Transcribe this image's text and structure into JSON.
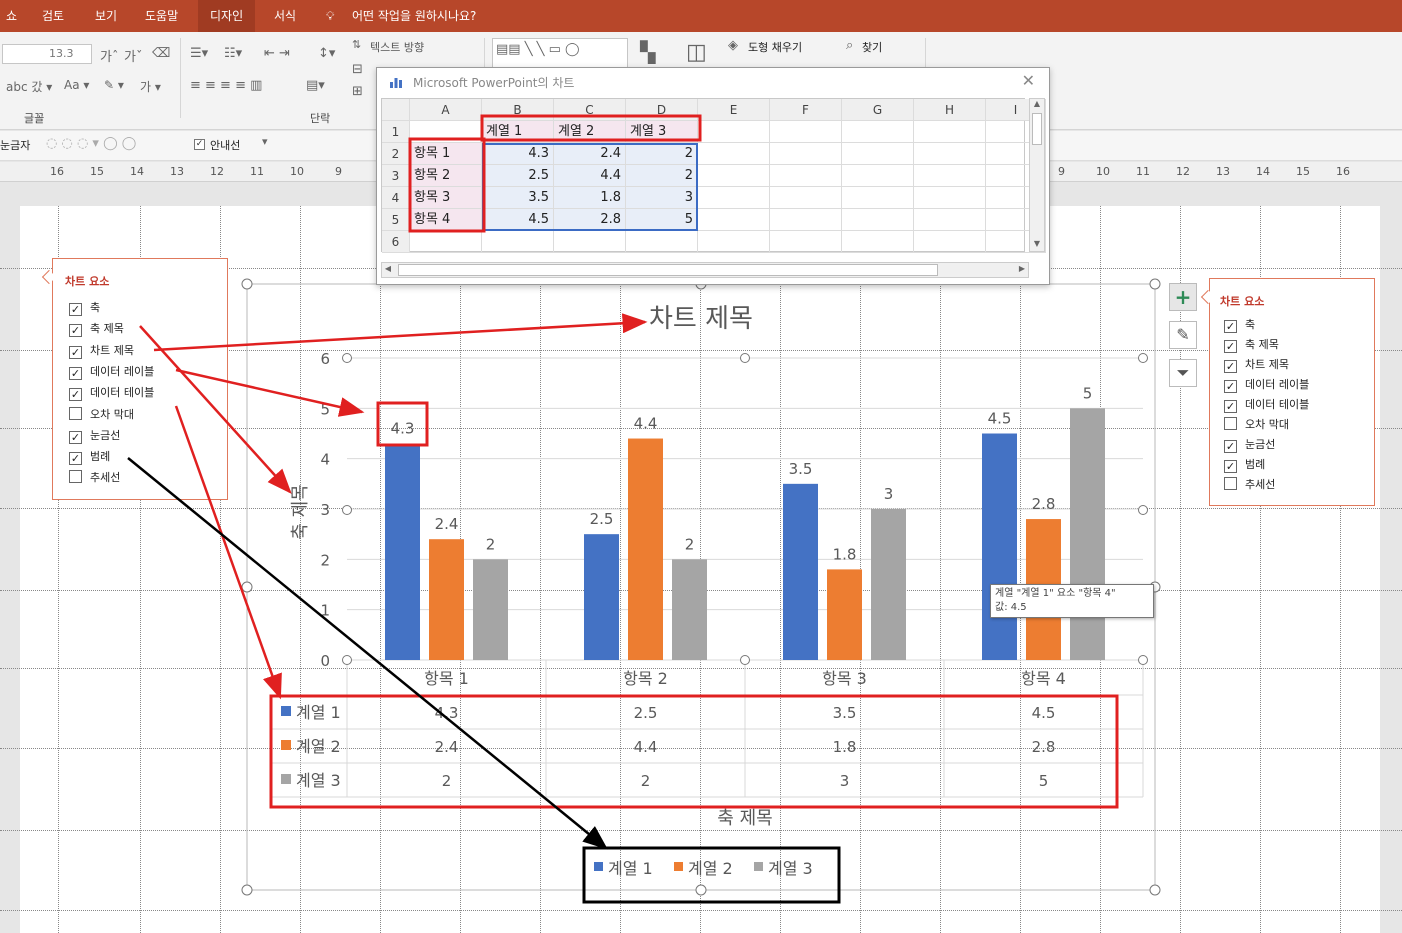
{
  "ribbon": {
    "tabs": [
      "쇼",
      "검토",
      "보기",
      "도움말",
      "디자인",
      "서식"
    ],
    "active_tab": "디자인",
    "tell_me": "어떤 작업을 원하시나요?",
    "font_size": "13.3",
    "groups": {
      "font": "글꼴",
      "paragraph": "단락"
    },
    "text_direction": "텍스트 방향",
    "shape_fill": "도형 채우기",
    "find": "찾기",
    "guides_prefix": "눈금자",
    "guides_label": "안내선"
  },
  "ruler": {
    "ticks_left": [
      "16",
      "15",
      "14",
      "13",
      "12",
      "11",
      "10",
      "9"
    ],
    "ticks_right": [
      "9",
      "10",
      "11",
      "12",
      "13",
      "14",
      "15",
      "16"
    ]
  },
  "excel": {
    "title": "Microsoft PowerPoint의 차트",
    "columns": [
      "A",
      "B",
      "C",
      "D",
      "E",
      "F",
      "G",
      "H",
      "I"
    ],
    "row_numbers": [
      "1",
      "2",
      "3",
      "4",
      "5",
      "6"
    ],
    "headers": [
      "계열 1",
      "계열 2",
      "계열 3"
    ],
    "rows": [
      {
        "label": "항목 1",
        "values": [
          "4.3",
          "2.4",
          "2"
        ]
      },
      {
        "label": "항목 2",
        "values": [
          "2.5",
          "4.4",
          "2"
        ]
      },
      {
        "label": "항목 3",
        "values": [
          "3.5",
          "1.8",
          "3"
        ]
      },
      {
        "label": "항목 4",
        "values": [
          "4.5",
          "2.8",
          "5"
        ]
      }
    ]
  },
  "chart_elements_left": {
    "title": "차트 요소",
    "items": [
      {
        "label": "축",
        "checked": true
      },
      {
        "label": "축 제목",
        "checked": true
      },
      {
        "label": "차트 제목",
        "checked": true
      },
      {
        "label": "데이터 레이블",
        "checked": true
      },
      {
        "label": "데이터 테이블",
        "checked": true
      },
      {
        "label": "오차 막대",
        "checked": false
      },
      {
        "label": "눈금선",
        "checked": true
      },
      {
        "label": "범례",
        "checked": true
      },
      {
        "label": "추세선",
        "checked": false
      }
    ]
  },
  "chart_elements_right": {
    "title": "차트 요소",
    "items": [
      {
        "label": "축",
        "checked": true
      },
      {
        "label": "축 제목",
        "checked": true
      },
      {
        "label": "차트 제목",
        "checked": true
      },
      {
        "label": "데이터 레이블",
        "checked": true
      },
      {
        "label": "데이터 테이블",
        "checked": true
      },
      {
        "label": "오차 막대",
        "checked": false
      },
      {
        "label": "눈금선",
        "checked": true
      },
      {
        "label": "범례",
        "checked": true
      },
      {
        "label": "추세선",
        "checked": false
      }
    ]
  },
  "tooltip": {
    "line1": "계열 \"계열 1\" 요소 \"항목 4\"",
    "line2": "값: 4.5"
  },
  "colors": {
    "series": [
      "#4472c4",
      "#ed7d31",
      "#a5a5a5"
    ],
    "annotation_red": "#e02020",
    "annotation_black": "#000000",
    "ribbon": "#b7472a"
  },
  "chart_data": {
    "type": "bar",
    "title": "차트 제목",
    "xlabel": "축 제목",
    "ylabel": "축 제목",
    "categories": [
      "항목 1",
      "항목 2",
      "항목 3",
      "항목 4"
    ],
    "series": [
      {
        "name": "계열 1",
        "values": [
          4.3,
          2.5,
          3.5,
          4.5
        ]
      },
      {
        "name": "계열 2",
        "values": [
          2.4,
          4.4,
          1.8,
          2.8
        ]
      },
      {
        "name": "계열 3",
        "values": [
          2,
          2,
          3,
          5
        ]
      }
    ],
    "ylim": [
      0,
      6
    ],
    "yticks": [
      "0",
      "1",
      "2",
      "3",
      "4",
      "5",
      "6"
    ],
    "grid": true,
    "data_labels": true,
    "data_table": true,
    "legend_position": "bottom"
  }
}
